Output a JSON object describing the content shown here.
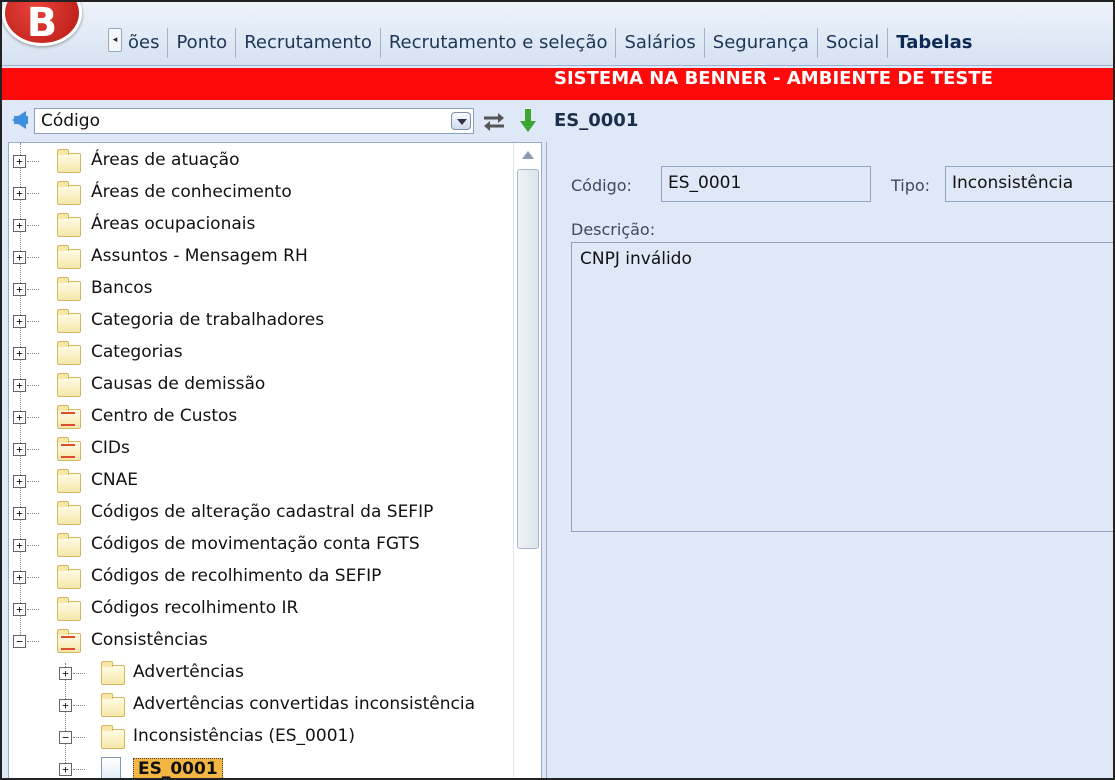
{
  "menu": {
    "items": [
      {
        "label": "ões"
      },
      {
        "label": "Ponto"
      },
      {
        "label": "Recrutamento"
      },
      {
        "label": "Recrutamento e seleção"
      },
      {
        "label": "Salários"
      },
      {
        "label": "Segurança"
      },
      {
        "label": "Social"
      },
      {
        "label": "Tabelas"
      }
    ],
    "logo_letter": "B"
  },
  "banner": {
    "text": "SISTEMA NA BENNER - AMBIENTE DE TESTE",
    "color": "#ff0a0a"
  },
  "toolbar": {
    "combo_value": "Código",
    "record_title": "ES_0001"
  },
  "tree": {
    "items": [
      {
        "label": "Áreas de atuação"
      },
      {
        "label": "Áreas de conhecimento"
      },
      {
        "label": "Áreas ocupacionais"
      },
      {
        "label": "Assuntos - Mensagem RH"
      },
      {
        "label": "Bancos"
      },
      {
        "label": "Categoria de trabalhadores"
      },
      {
        "label": "Categorias"
      },
      {
        "label": "Causas de demissão"
      },
      {
        "label": "Centro de Custos"
      },
      {
        "label": "CIDs"
      },
      {
        "label": "CNAE"
      },
      {
        "label": "Códigos de alteração cadastral da SEFIP"
      },
      {
        "label": "Códigos de movimentação conta FGTS"
      },
      {
        "label": "Códigos de recolhimento da SEFIP"
      },
      {
        "label": "Códigos recolhimento IR"
      },
      {
        "label": "Consistências"
      }
    ],
    "children": [
      {
        "label": "Advertências"
      },
      {
        "label": "Advertências convertidas inconsistência"
      },
      {
        "label": "Inconsistências (ES_0001)"
      }
    ],
    "selected": {
      "label": "ES_0001"
    }
  },
  "form": {
    "codigo_label": "Código:",
    "codigo_value": "ES_0001",
    "tipo_label": "Tipo:",
    "tipo_value": "Inconsistência",
    "descricao_label": "Descrição:",
    "descricao_value": "CNPJ inválido"
  }
}
